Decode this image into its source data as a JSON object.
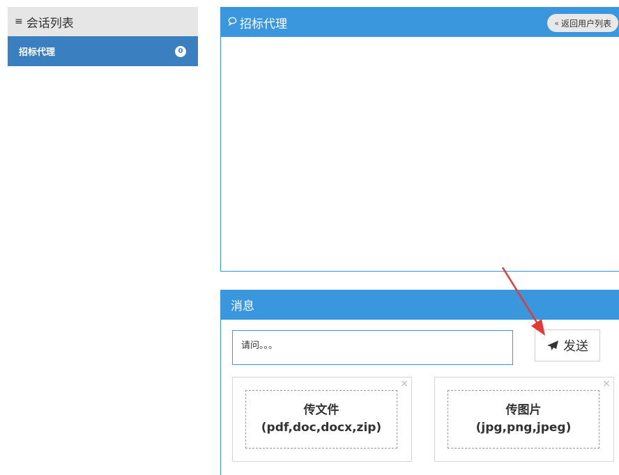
{
  "sidebar": {
    "title": "会话列表",
    "title_icon": "list-icon",
    "items": [
      {
        "label": "招标代理",
        "badge": "0"
      }
    ]
  },
  "chat": {
    "title": "招标代理",
    "title_icon": "comment-icon",
    "back_label": "返回用户列表",
    "back_icon": "double-chevron-left-icon"
  },
  "message": {
    "title": "消息",
    "input_value": "请问。。。",
    "send_label": "发送",
    "send_icon": "paper-plane-icon"
  },
  "uploads": {
    "file": {
      "title": "传文件",
      "types": "(pdf,doc,docx,zip)"
    },
    "image": {
      "title": "传图片",
      "types": "(jpg,png,jpeg)"
    }
  },
  "colors": {
    "primary": "#3a97dd",
    "sidebar_active": "#3a80c0",
    "sidebar_header": "#e6e6e6",
    "annotation_arrow": "#e53935"
  }
}
